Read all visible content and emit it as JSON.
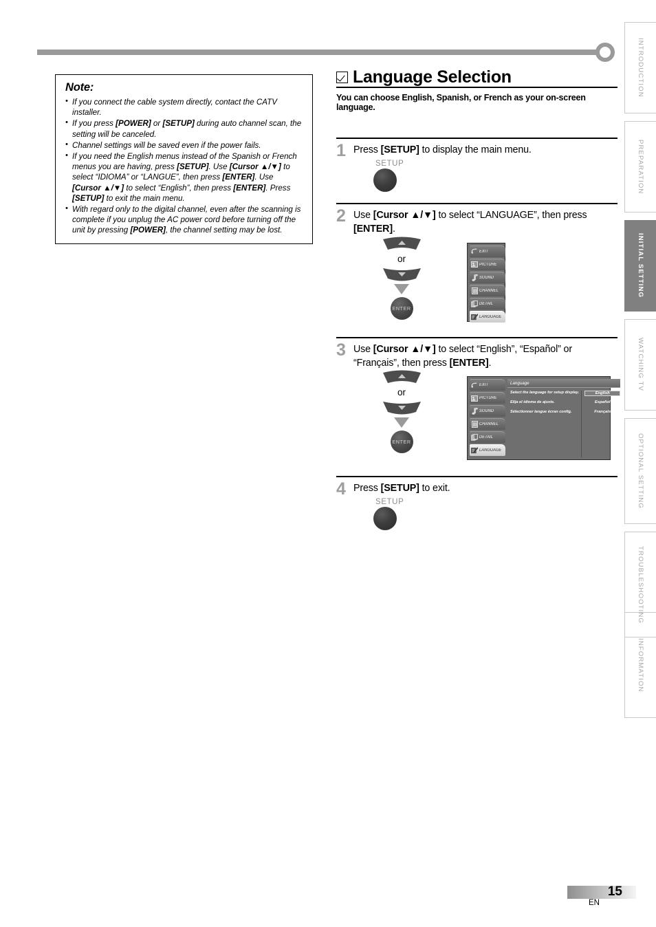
{
  "note": {
    "title": "Note:",
    "items": [
      "If you connect the cable system directly, contact the CATV installer.",
      "If you press [POWER] or [SETUP] during auto channel scan, the setting will be canceled.",
      "Channel settings will be saved even if the power fails.",
      "If you need the English menus instead of the Spanish or French menus you are having, press [SETUP]. Use [Cursor ▲/▼] to select “IDIOMA” or “LANGUE”, then press [ENTER]. Use [Cursor ▲/▼] to select “English”, then press [ENTER]. Press [SETUP] to exit the main menu.",
      "With regard only to the digital channel, even after the scanning is complete if you unplug the AC power cord before turning off the unit by pressing [POWER], the channel setting may be lost."
    ]
  },
  "section": {
    "title": "Language Selection",
    "subtitle": "You can choose English, Spanish, or French as your on-screen language.",
    "checkbox_glyph": "checked-box-icon"
  },
  "steps": [
    {
      "number": "1",
      "text": "Press [SETUP] to display the main menu.",
      "button_label": "SETUP"
    },
    {
      "number": "2",
      "text": "Use [Cursor ▲/▼] to select “LANGUAGE”, then press [ENTER].",
      "or_label": "or",
      "enter_label": "ENTER"
    },
    {
      "number": "3",
      "text": "Use [Cursor ▲/▼] to select “English”, “Español” or “Français”, then press [ENTER].",
      "or_label": "or",
      "enter_label": "ENTER"
    },
    {
      "number": "4",
      "text": "Press [SETUP] to exit.",
      "button_label": "SETUP"
    }
  ],
  "osd_menu": {
    "items": [
      {
        "label": "EXIT",
        "icon": "exit-arrow-icon",
        "selected": false
      },
      {
        "label": "PICTURE",
        "icon": "picture-icon",
        "selected": false
      },
      {
        "label": "SOUND",
        "icon": "music-note-icon",
        "selected": false
      },
      {
        "label": "CHANNEL",
        "icon": "channel-bars-icon",
        "selected": false
      },
      {
        "label": "DETAIL",
        "icon": "pages-icon",
        "selected": false
      },
      {
        "label": "LANGUAGE",
        "icon": "language-pencil-icon",
        "selected": true
      }
    ]
  },
  "osd_language_screen": {
    "title": "Language",
    "descriptions": [
      "Select the language for setup display.",
      "Elija el idioma de ajuste.",
      "Sélectionner langue écran config."
    ],
    "options": [
      {
        "label": "English",
        "selected": true
      },
      {
        "label": "Español",
        "selected": false
      },
      {
        "label": "Français",
        "selected": false
      }
    ]
  },
  "edge_tabs": [
    {
      "label": "INTRODUCTION",
      "active": false
    },
    {
      "label": "PREPARATION",
      "active": false
    },
    {
      "label": "INITIAL SETTING",
      "active": true
    },
    {
      "label": "WATCHING TV",
      "active": false
    },
    {
      "label": "OPTIONAL SETTING",
      "active": false
    },
    {
      "label": "TROUBLESHOOTING",
      "active": false
    },
    {
      "label": "INFORMATION",
      "active": false
    }
  ],
  "footer": {
    "page_number": "15",
    "language_code": "EN"
  },
  "colors": {
    "active_tab": "#808080",
    "inactive_tab_text": "#a8a8a8",
    "rule": "#9a9a9a",
    "step_number": "#9e9e9e",
    "osd_background": "#6f6f6f"
  }
}
